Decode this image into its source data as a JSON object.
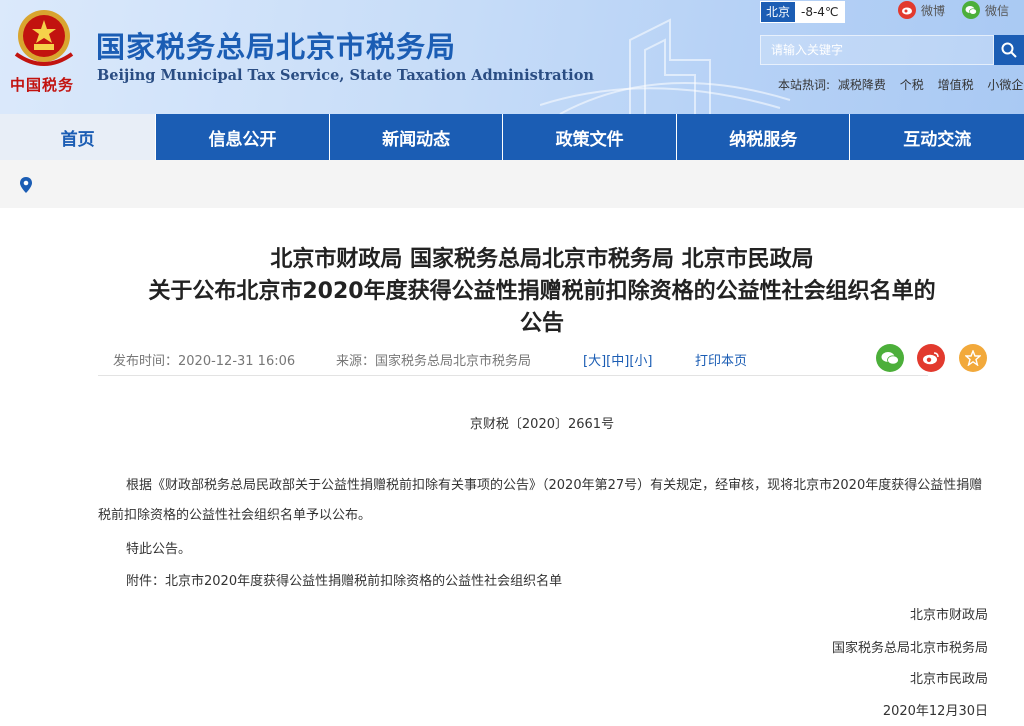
{
  "header": {
    "logo_caption": "中国税务",
    "title": "国家税务总局北京市税务局",
    "subtitle": "Beijing Municipal Tax Service, State Taxation Administration",
    "weather_city": "北京",
    "weather_temp": "-8-4℃",
    "weibo_label": "微博",
    "weixin_label": "微信",
    "search_placeholder": "请输入关键字",
    "hot_label": "本站热词:",
    "hot_words": [
      "减税降费",
      "个税",
      "增值税",
      "小微企"
    ]
  },
  "nav": {
    "tabs": [
      "首页",
      "信息公开",
      "新闻动态",
      "政策文件",
      "纳税服务",
      "互动交流"
    ]
  },
  "article": {
    "title_line1": "北京市财政局 国家税务总局北京市税务局 北京市民政局",
    "title_line2": "关于公布北京市2020年度获得公益性捐赠税前扣除资格的公益性社会组织名单的",
    "title_line3": "公告",
    "publish_time": "发布时间：2020-12-31 16:06",
    "source": "来源：国家税务总局北京市税务局",
    "size_large": "[大]",
    "size_medium": "[中]",
    "size_small": "[小]",
    "print_label": "打印本页",
    "doc_no": "京财税〔2020〕2661号",
    "paragraph1": "根据《财政部税务总局民政部关于公益性捐赠税前扣除有关事项的公告》（2020年第27号）有关规定，经审核，现将北京市2020年度获得公益性捐赠税前扣除资格的公益性社会组织名单予以公布。",
    "paragraph2": "特此公告。",
    "paragraph3": "附件：北京市2020年度获得公益性捐赠税前扣除资格的公益性社会组织名单",
    "sign1": "北京市财政局",
    "sign2": "国家税务总局北京市税务局",
    "sign3": "北京市民政局",
    "date": "2020年12月30日"
  },
  "colors": {
    "brand_blue": "#1b5db4",
    "emblem_red": "#c2130f",
    "wechat_green": "#4caf3a",
    "weibo_red": "#e23a2e",
    "favorite_orange": "#f2a93b"
  }
}
